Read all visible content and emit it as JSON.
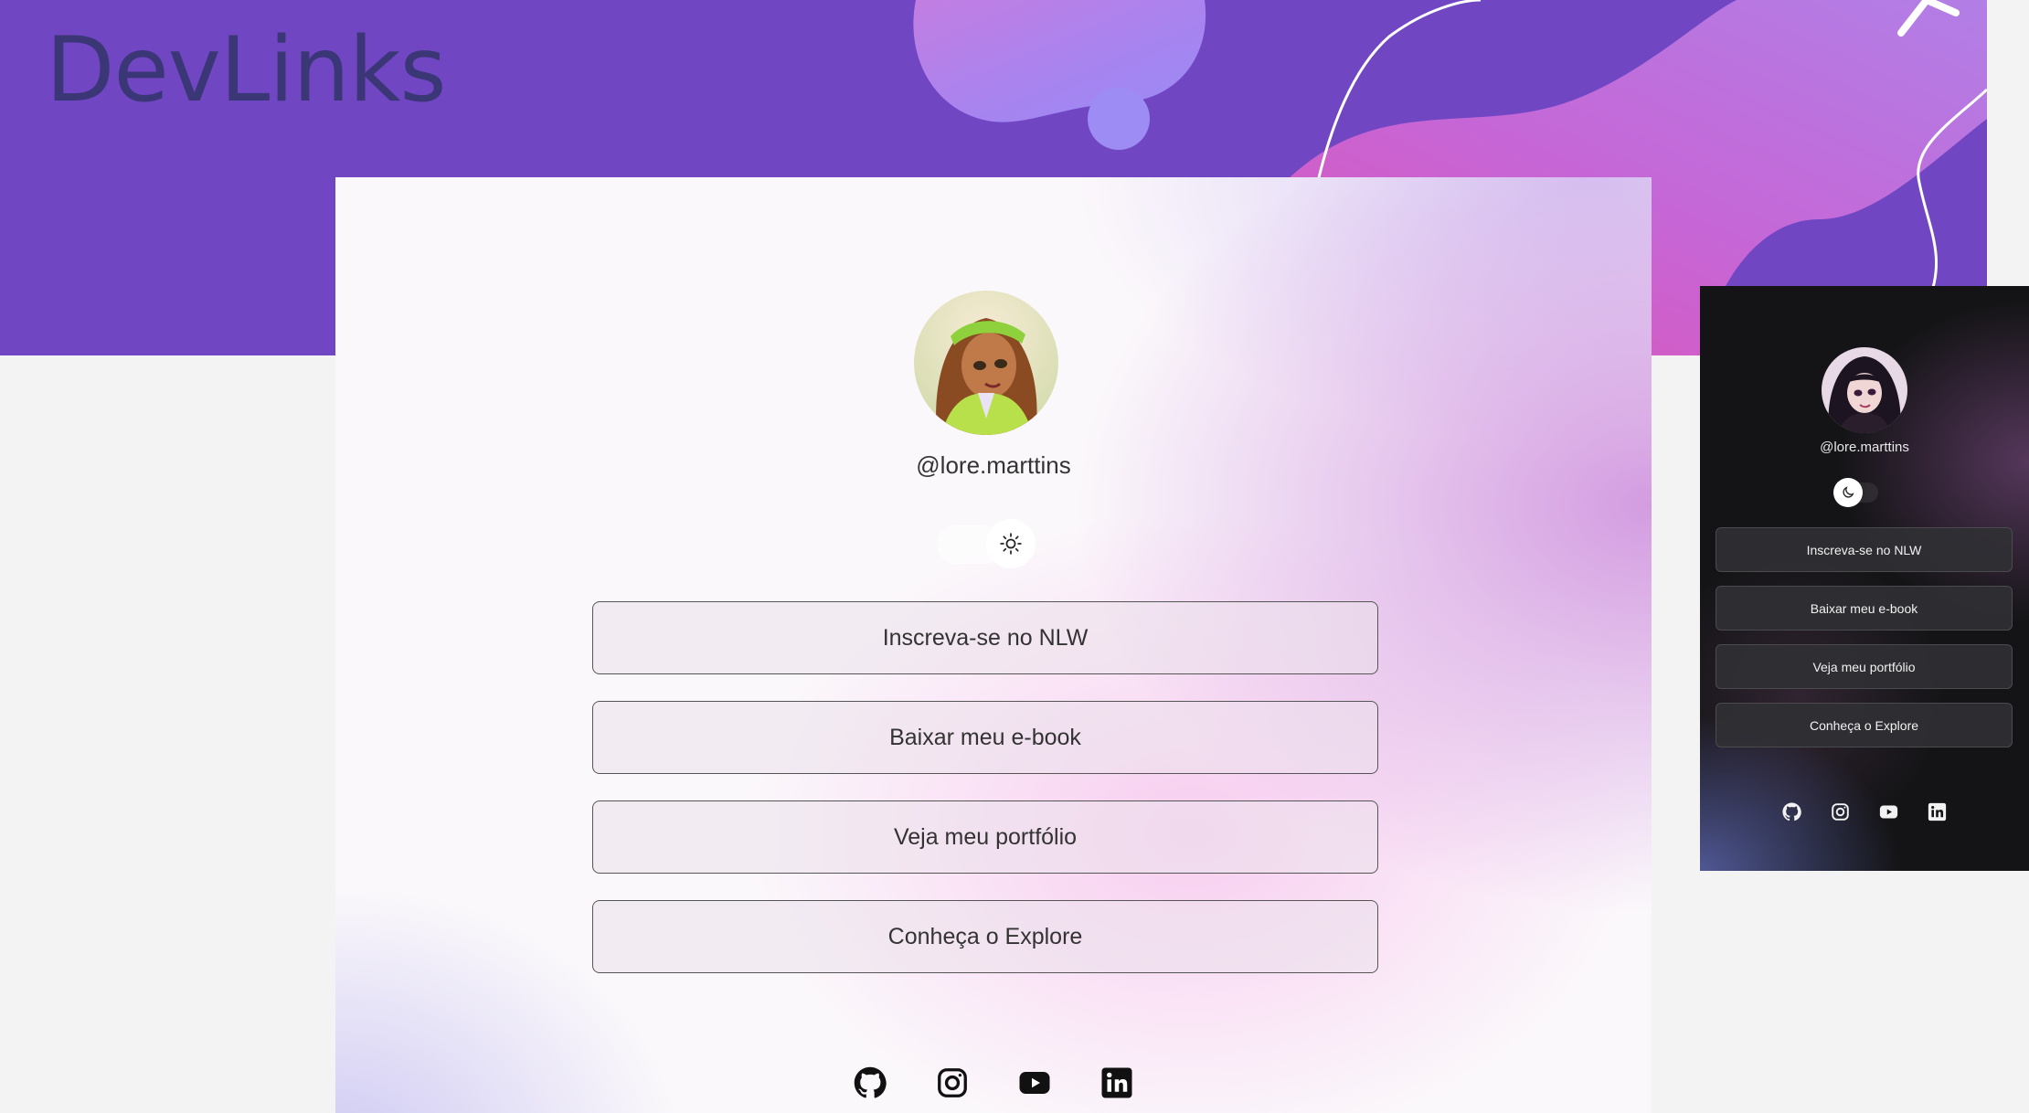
{
  "brand": {
    "title": "DevLinks"
  },
  "light_preview": {
    "username": "@lore.marttins",
    "theme_toggle_icon": "sun-icon",
    "links": [
      {
        "label": "Inscreva-se no NLW"
      },
      {
        "label": "Baixar meu e-book"
      },
      {
        "label": "Veja meu portfólio"
      },
      {
        "label": "Conheça o Explore"
      }
    ],
    "socials": [
      "github-icon",
      "instagram-icon",
      "youtube-icon",
      "linkedin-icon"
    ]
  },
  "dark_preview": {
    "username": "@lore.marttins",
    "theme_toggle_icon": "moon-icon",
    "links": [
      {
        "label": "Inscreva-se no NLW"
      },
      {
        "label": "Baixar meu e-book"
      },
      {
        "label": "Veja meu portfólio"
      },
      {
        "label": "Conheça o Explore"
      }
    ],
    "socials": [
      "github-icon",
      "instagram-icon",
      "youtube-icon",
      "linkedin-icon"
    ]
  },
  "colors": {
    "hero_background": "#7046c3",
    "brand_text": "#3b3676",
    "page_background": "#f3f3f3",
    "dark_card_background": "#141416"
  }
}
